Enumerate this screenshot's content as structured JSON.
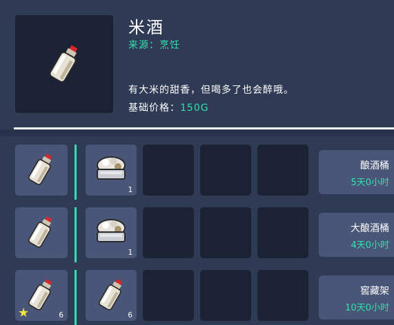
{
  "item": {
    "name": "米酒",
    "source_label": "来源：",
    "source_value": "烹饪",
    "description": "有大米的甜香，但喝多了也会醉哦。",
    "price_label": "基础价格：",
    "price_value": "150G",
    "icon": "rice-wine-bottle-icon"
  },
  "recipes": [
    {
      "result_icon": "rice-wine-bottle-icon",
      "result_qty": "",
      "result_star": false,
      "ingredients": [
        {
          "icon": "rice-bowl-icon",
          "qty": "1"
        },
        {
          "icon": "",
          "qty": ""
        },
        {
          "icon": "",
          "qty": ""
        },
        {
          "icon": "",
          "qty": ""
        }
      ],
      "facility": "酿酒桶",
      "time": "5天0小时"
    },
    {
      "result_icon": "rice-wine-bottle-icon",
      "result_qty": "",
      "result_star": false,
      "ingredients": [
        {
          "icon": "rice-bowl-icon",
          "qty": "1"
        },
        {
          "icon": "",
          "qty": ""
        },
        {
          "icon": "",
          "qty": ""
        },
        {
          "icon": "",
          "qty": ""
        }
      ],
      "facility": "大酿酒桶",
      "time": "4天0小时"
    },
    {
      "result_icon": "rice-wine-bottle-icon",
      "result_qty": "6",
      "result_star": true,
      "ingredients": [
        {
          "icon": "rice-wine-bottle-icon",
          "qty": "6"
        },
        {
          "icon": "",
          "qty": ""
        },
        {
          "icon": "",
          "qty": ""
        },
        {
          "icon": "",
          "qty": ""
        }
      ],
      "facility": "窖藏架",
      "time": "10天0小时"
    }
  ],
  "colors": {
    "background": "#2f3a55",
    "slot_dark": "#1b2233",
    "slot_light": "#4a5677",
    "accent": "#33e0b0",
    "star": "#f6e23d"
  }
}
